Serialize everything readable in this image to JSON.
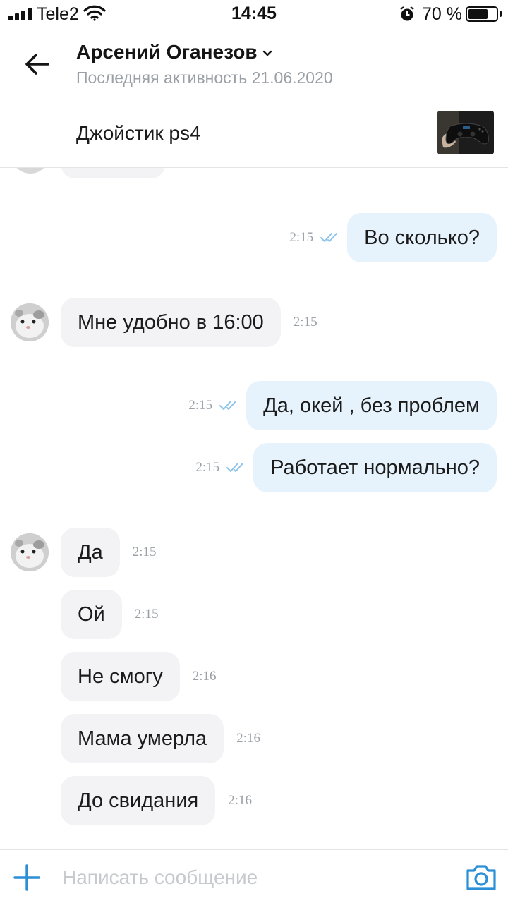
{
  "status_bar": {
    "carrier": "Tele2",
    "time": "14:45",
    "battery": "70 %",
    "battery_level": 0.7,
    "icons": [
      "signal-icon",
      "wifi-icon",
      "alarm-icon",
      "battery-icon"
    ]
  },
  "header": {
    "name": "Арсений Оганезов",
    "status": "Последняя активность 21.06.2020",
    "icons": [
      "back-arrow-icon",
      "chevron-down-icon"
    ]
  },
  "listing": {
    "title": "Джойстик ps4"
  },
  "messages": [
    {
      "dir": "out",
      "text": "Во сколько?",
      "time": "2:15"
    },
    {
      "dir": "in",
      "text": "Мне удобно в 16:00",
      "time": "2:15"
    },
    {
      "dir": "out",
      "text": "Да, окей , без проблем",
      "time": "2:15"
    },
    {
      "dir": "out",
      "text": "Работает нормально?",
      "time": "2:15"
    },
    {
      "dir": "in",
      "text": "Да",
      "time": "2:15"
    },
    {
      "dir": "in",
      "text": "Ой",
      "time": "2:15"
    },
    {
      "dir": "in",
      "text": "Не смогу",
      "time": "2:16"
    },
    {
      "dir": "in",
      "text": "Мама умерла",
      "time": "2:16"
    },
    {
      "dir": "in",
      "text": "До свидания",
      "time": "2:16"
    }
  ],
  "composer": {
    "placeholder": "Написать сообщение",
    "icons": [
      "plus-icon",
      "camera-icon"
    ]
  },
  "colors": {
    "accent": "#2a8fd6",
    "incoming_bubble": "#f3f3f5",
    "outgoing_bubble": "#e6f3fc",
    "read_checks": "#8cc4ea"
  }
}
